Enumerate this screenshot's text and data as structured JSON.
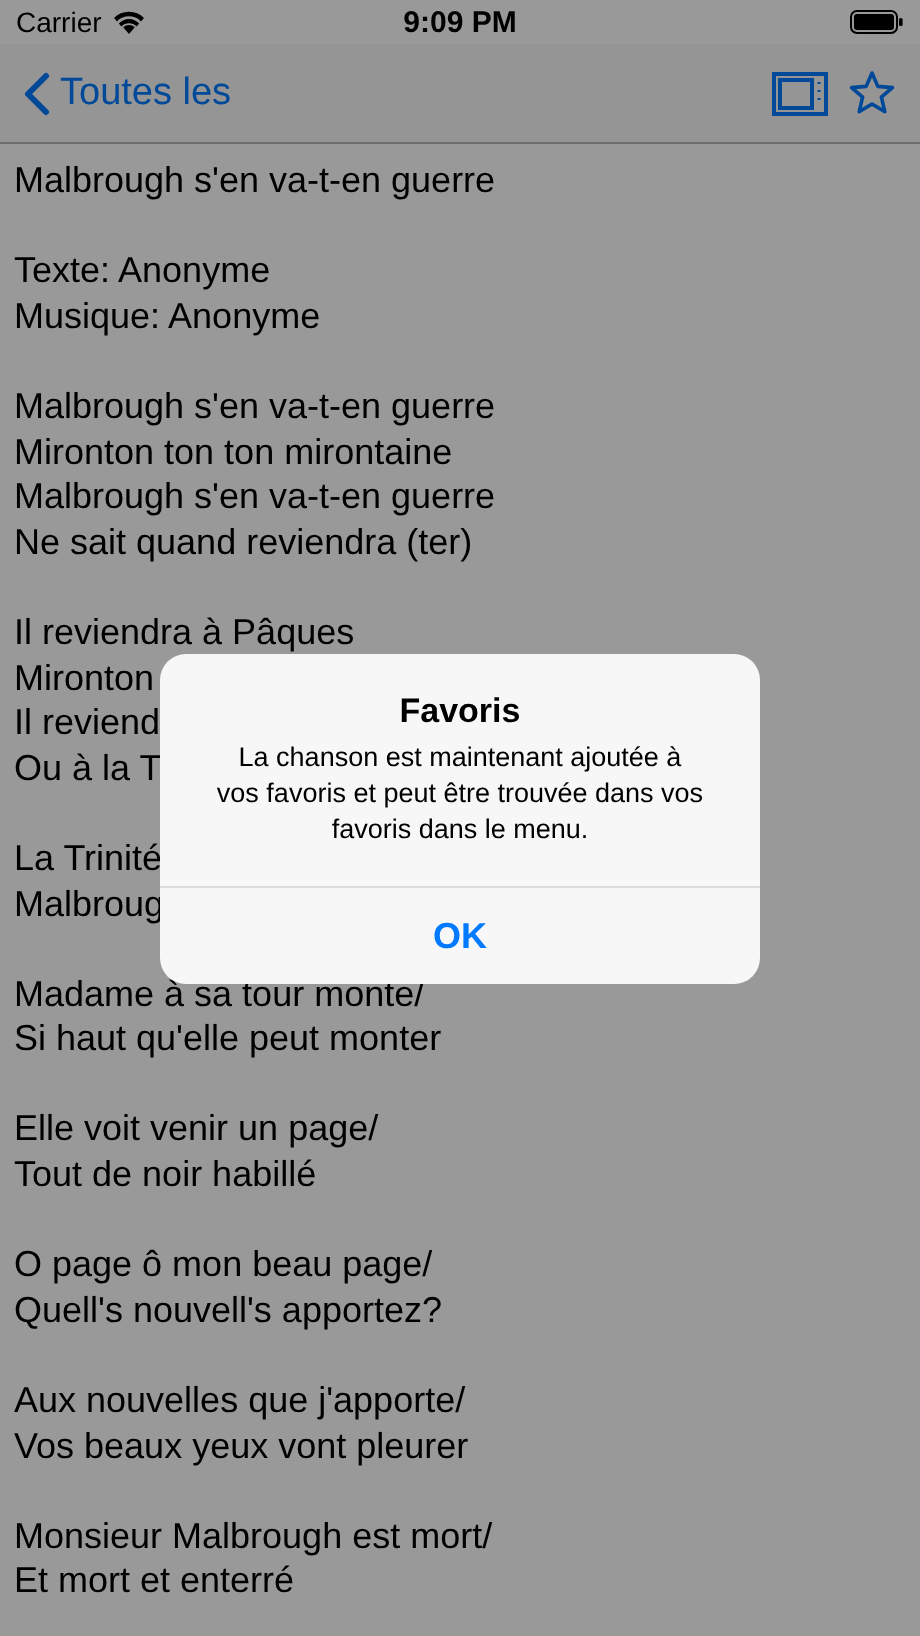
{
  "status_bar": {
    "carrier": "Carrier",
    "time": "9:09 PM"
  },
  "nav_bar": {
    "back_label": "Toutes les"
  },
  "lyrics": [
    [
      "Malbrough s'en va-t-en guerre"
    ],
    [
      "Texte: Anonyme",
      "Musique: Anonyme"
    ],
    [
      "Malbrough s'en va-t-en guerre",
      "Mironton ton ton mirontaine",
      "Malbrough s'en va-t-en guerre",
      "Ne sait quand reviendra (ter)"
    ],
    [
      "Il reviendra à Pâques",
      "Mironton",
      "Il reviend",
      "Ou à la T"
    ],
    [
      "La Trinité",
      "Malbroug"
    ],
    [
      "Madame à sa tour monte/",
      "Si haut qu'elle peut monter"
    ],
    [
      "Elle voit venir un page/",
      "Tout de noir habillé"
    ],
    [
      "O page ô mon beau page/",
      "Quell's nouvell's apportez?"
    ],
    [
      "Aux nouvelles que j'apporte/",
      "Vos beaux yeux vont pleurer"
    ],
    [
      "Monsieur Malbrough est mort/",
      "Et mort et enterré"
    ]
  ],
  "alert": {
    "title": "Favoris",
    "message": "La chanson est maintenant ajoutée à vos favoris et peut être trouvée dans vos favoris dans le menu.",
    "buttons": [
      "OK"
    ]
  }
}
